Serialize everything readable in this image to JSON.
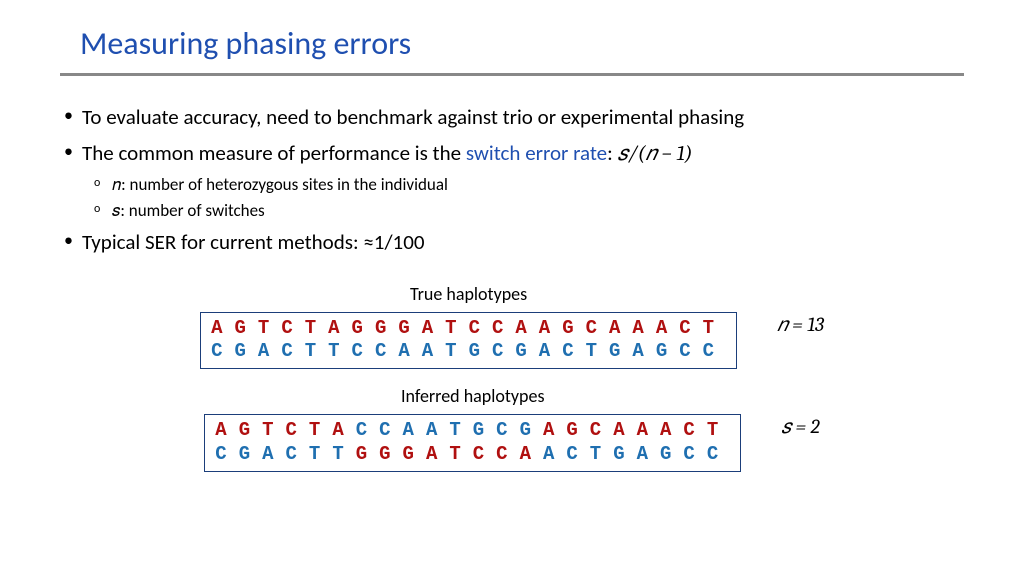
{
  "title": "Measuring phasing errors",
  "bullets": {
    "b1": "To evaluate accuracy, need to benchmark against trio or experimental phasing",
    "b2_pre": "The common measure of performance is the ",
    "b2_blue": "switch error rate",
    "b2_colon": ": ",
    "b2_formula": "𝑠/(𝑛 − 1)",
    "b2_sub1": "𝑛: number of heterozygous sites in the individual",
    "b2_sub2": "𝑠: number of switches",
    "b3": "Typical SER for current methods: ≈1/100"
  },
  "captions": {
    "true": "True haplotypes",
    "inferred": "Inferred haplotypes"
  },
  "true_hap": {
    "top": [
      [
        "A",
        "r"
      ],
      [
        "G",
        "r"
      ],
      [
        "T",
        "r"
      ],
      [
        "C",
        "r"
      ],
      [
        "T",
        "r"
      ],
      [
        "A",
        "r"
      ],
      [
        "G",
        "r"
      ],
      [
        "G",
        "r"
      ],
      [
        "G",
        "r"
      ],
      [
        "A",
        "r"
      ],
      [
        "T",
        "r"
      ],
      [
        "C",
        "r"
      ],
      [
        "C",
        "r"
      ],
      [
        "A",
        "r"
      ],
      [
        "A",
        "r"
      ],
      [
        "G",
        "r"
      ],
      [
        "C",
        "r"
      ],
      [
        "A",
        "r"
      ],
      [
        "A",
        "r"
      ],
      [
        "A",
        "r"
      ],
      [
        "C",
        "r"
      ],
      [
        "T",
        "r"
      ]
    ],
    "bot": [
      [
        "C",
        "b"
      ],
      [
        "G",
        "b"
      ],
      [
        "A",
        "b"
      ],
      [
        "C",
        "b"
      ],
      [
        "T",
        "b"
      ],
      [
        "T",
        "b"
      ],
      [
        "C",
        "b"
      ],
      [
        "C",
        "b"
      ],
      [
        "A",
        "b"
      ],
      [
        "A",
        "b"
      ],
      [
        "T",
        "b"
      ],
      [
        "G",
        "b"
      ],
      [
        "C",
        "b"
      ],
      [
        "G",
        "b"
      ],
      [
        "A",
        "b"
      ],
      [
        "C",
        "b"
      ],
      [
        "T",
        "b"
      ],
      [
        "G",
        "b"
      ],
      [
        "A",
        "b"
      ],
      [
        "G",
        "b"
      ],
      [
        "C",
        "b"
      ],
      [
        "C",
        "b"
      ]
    ]
  },
  "inf_hap": {
    "top": [
      [
        "A",
        "r"
      ],
      [
        "G",
        "r"
      ],
      [
        "T",
        "r"
      ],
      [
        "C",
        "r"
      ],
      [
        "T",
        "r"
      ],
      [
        "A",
        "r"
      ],
      [
        "C",
        "b"
      ],
      [
        "C",
        "b"
      ],
      [
        "A",
        "b"
      ],
      [
        "A",
        "b"
      ],
      [
        "T",
        "b"
      ],
      [
        "G",
        "b"
      ],
      [
        "C",
        "b"
      ],
      [
        "G",
        "b"
      ],
      [
        "A",
        "r"
      ],
      [
        "G",
        "r"
      ],
      [
        "C",
        "r"
      ],
      [
        "A",
        "r"
      ],
      [
        "A",
        "r"
      ],
      [
        "A",
        "r"
      ],
      [
        "C",
        "r"
      ],
      [
        "T",
        "r"
      ]
    ],
    "bot": [
      [
        "C",
        "b"
      ],
      [
        "G",
        "b"
      ],
      [
        "A",
        "b"
      ],
      [
        "C",
        "b"
      ],
      [
        "T",
        "b"
      ],
      [
        "T",
        "b"
      ],
      [
        "G",
        "r"
      ],
      [
        "G",
        "r"
      ],
      [
        "G",
        "r"
      ],
      [
        "A",
        "r"
      ],
      [
        "T",
        "r"
      ],
      [
        "C",
        "r"
      ],
      [
        "C",
        "r"
      ],
      [
        "A",
        "r"
      ],
      [
        "A",
        "b"
      ],
      [
        "C",
        "b"
      ],
      [
        "T",
        "b"
      ],
      [
        "G",
        "b"
      ],
      [
        "A",
        "b"
      ],
      [
        "G",
        "b"
      ],
      [
        "C",
        "b"
      ],
      [
        "C",
        "b"
      ]
    ]
  },
  "side": {
    "n": "𝑛 = 13",
    "s": "𝑠 = 2"
  }
}
